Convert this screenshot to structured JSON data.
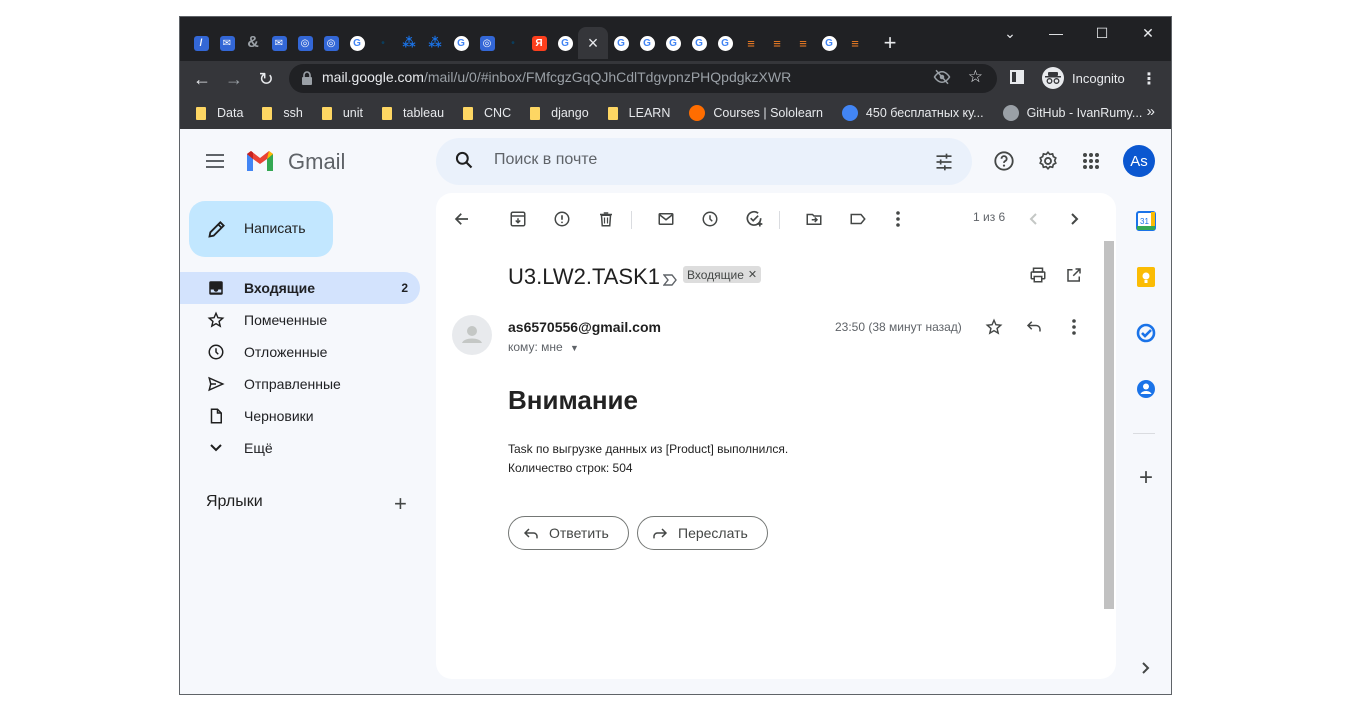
{
  "browser": {
    "tabs": [
      {
        "icon": "slash-icon",
        "color": "#3367d6",
        "glyph": "/"
      },
      {
        "icon": "mail-icon",
        "color": "#3367d6",
        "glyph": "✉"
      },
      {
        "icon": "ampersand-icon",
        "color": "#5f6368",
        "glyph": "&"
      },
      {
        "icon": "mail-icon",
        "color": "#3367d6",
        "glyph": "✉"
      },
      {
        "icon": "app-icon",
        "color": "#3367d6",
        "glyph": "◎"
      },
      {
        "icon": "app-icon",
        "color": "#3367d6",
        "glyph": "◎"
      },
      {
        "icon": "google-icon",
        "color": "#ffffff",
        "glyph": "G"
      },
      {
        "icon": "dot-icon",
        "color": "#0b3d5c",
        "glyph": "•"
      },
      {
        "icon": "nodes-icon",
        "color": "#1a73e8",
        "glyph": "⁂"
      },
      {
        "icon": "nodes-icon",
        "color": "#1a73e8",
        "glyph": "⁂"
      },
      {
        "icon": "google-icon",
        "color": "#ffffff",
        "glyph": "G"
      },
      {
        "icon": "app-icon",
        "color": "#3367d6",
        "glyph": "◎"
      },
      {
        "icon": "dot-icon",
        "color": "#0b3d5c",
        "glyph": "•"
      },
      {
        "icon": "yandex-icon",
        "color": "#fc3f1d",
        "glyph": "Я"
      },
      {
        "icon": "google-icon",
        "color": "#ffffff",
        "glyph": "G"
      }
    ],
    "active_tab_close": "×",
    "tabs_after": [
      {
        "icon": "google-icon",
        "color": "#ffffff",
        "glyph": "G"
      },
      {
        "icon": "google-icon",
        "color": "#ffffff",
        "glyph": "G"
      },
      {
        "icon": "google-icon",
        "color": "#ffffff",
        "glyph": "G"
      },
      {
        "icon": "google-icon",
        "color": "#ffffff",
        "glyph": "G"
      },
      {
        "icon": "google-icon",
        "color": "#ffffff",
        "glyph": "G"
      },
      {
        "icon": "stackoverflow-icon",
        "color": "#f48024",
        "glyph": "≡"
      },
      {
        "icon": "stackoverflow-icon",
        "color": "#f48024",
        "glyph": "≡"
      },
      {
        "icon": "stackoverflow-icon",
        "color": "#f48024",
        "glyph": "≡"
      },
      {
        "icon": "google-icon",
        "color": "#ffffff",
        "glyph": "G"
      },
      {
        "icon": "stackoverflow-icon",
        "color": "#f48024",
        "glyph": "≡"
      }
    ],
    "new_tab": "+",
    "url_host": "mail.google.com",
    "url_path": "/mail/u/0/#inbox/FMfcgzGqQJhCdlTdgvpnzPHQpdgkzXWR",
    "profile_label": "Incognito",
    "bookmarks": [
      {
        "label": "Data",
        "type": "folder"
      },
      {
        "label": "ssh",
        "type": "folder"
      },
      {
        "label": "unit",
        "type": "folder"
      },
      {
        "label": "tableau",
        "type": "folder"
      },
      {
        "label": "CNC",
        "type": "folder"
      },
      {
        "label": "django",
        "type": "folder"
      },
      {
        "label": "LEARN",
        "type": "folder"
      },
      {
        "label": "Courses | Sololearn",
        "type": "site"
      },
      {
        "label": "450 бесплатных ку...",
        "type": "site"
      },
      {
        "label": "GitHub - IvanRumy...",
        "type": "site"
      }
    ],
    "bookmarks_more": "»"
  },
  "gmail": {
    "brand": "Gmail",
    "search_placeholder": "Поиск в почте",
    "avatar_initials": "As",
    "compose_label": "Написать",
    "nav": [
      {
        "label": "Входящие",
        "count": "2",
        "icon": "inbox-icon",
        "active": true
      },
      {
        "label": "Помеченные",
        "count": "",
        "icon": "star-icon",
        "active": false
      },
      {
        "label": "Отложенные",
        "count": "",
        "icon": "clock-icon",
        "active": false
      },
      {
        "label": "Отправленные",
        "count": "",
        "icon": "send-icon",
        "active": false
      },
      {
        "label": "Черновики",
        "count": "",
        "icon": "draft-icon",
        "active": false
      },
      {
        "label": "Ещё",
        "count": "",
        "icon": "chevron-down-icon",
        "active": false
      }
    ],
    "labels_title": "Ярлыки"
  },
  "message": {
    "pager": "1 из 6",
    "subject": "U3.LW2.TASK1",
    "label_chip": "Входящие",
    "sender": "as6570556@gmail.com",
    "to": "кому: мне",
    "time": "23:50 (38 минут назад)",
    "heading": "Внимание",
    "body_line1": "Task по выгрузке данных из [Product] выполнился.",
    "body_line2": "Количество строк: 504",
    "reply_label": "Ответить",
    "forward_label": "Переслать"
  },
  "colors": {
    "accent": "#0b57d0",
    "compose_bg": "#c2e7ff",
    "nav_active": "#d3e3fd"
  }
}
